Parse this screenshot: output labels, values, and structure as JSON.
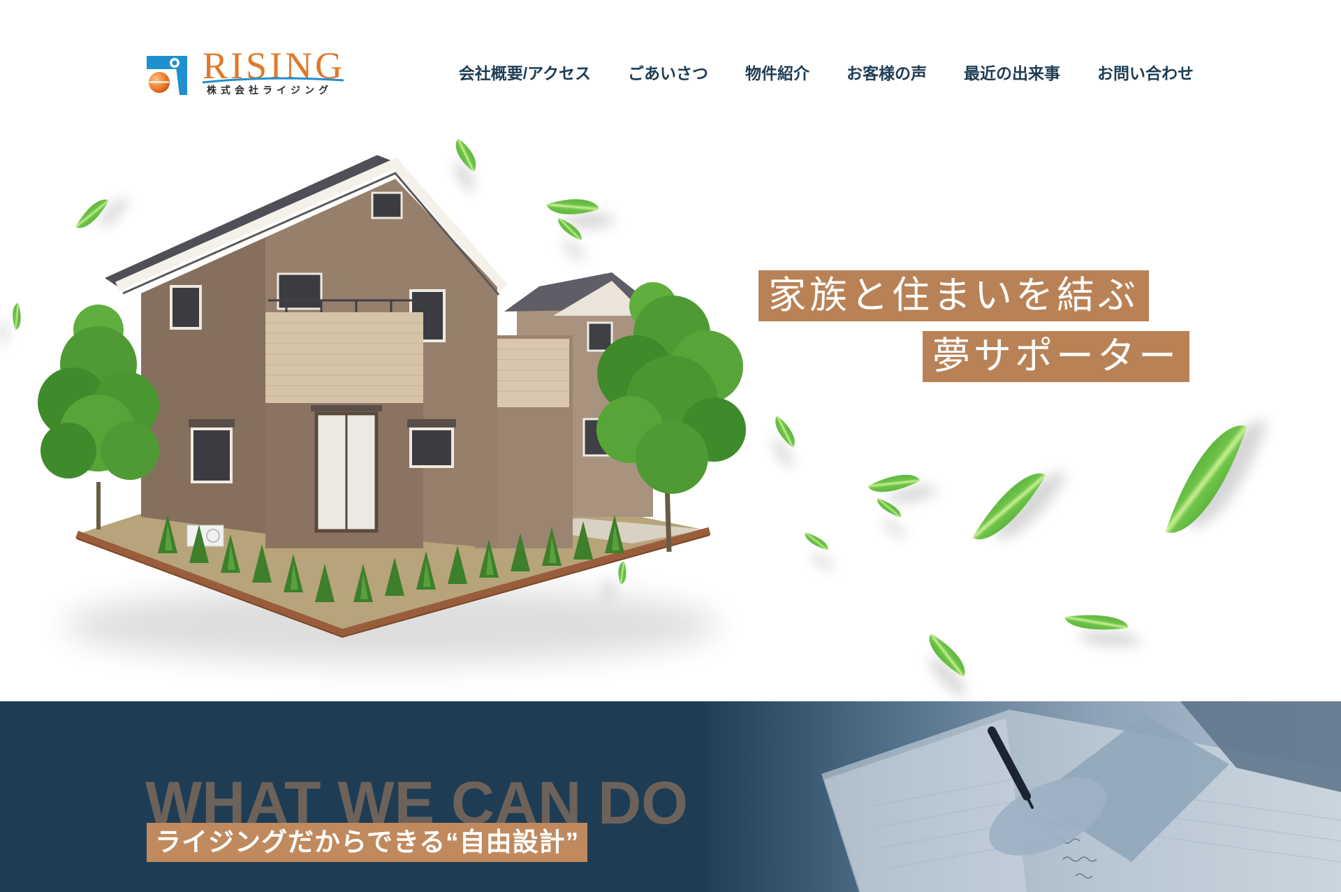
{
  "header": {
    "logo": {
      "name": "RISING",
      "subtitle": "株式会社ライジング",
      "icon": "rising-logo-icon"
    },
    "nav": [
      {
        "label": "会社概要/アクセス"
      },
      {
        "label": "ごあいさつ"
      },
      {
        "label": "物件紹介"
      },
      {
        "label": "お客様の声"
      },
      {
        "label": "最近の出来事"
      },
      {
        "label": "お問い合わせ"
      }
    ]
  },
  "hero": {
    "tagline_line1": "家族と住まいを結ぶ",
    "tagline_line2": "夢サポーター",
    "image": "house-illustration",
    "decoration_icon": "leaf-icon"
  },
  "about": {
    "heading": "WHAT WE CAN DO",
    "subheading": "ライジングだからできる“自由設計”",
    "image": "writing-hand-photo"
  },
  "colors": {
    "navy": "#1e3d55",
    "accent_brown": "#b98256",
    "subheading_brown": "#c08a5e",
    "logo_orange": "#e0782a",
    "logo_blue": "#1f8fd0",
    "leaf_green": "#6fc449"
  }
}
